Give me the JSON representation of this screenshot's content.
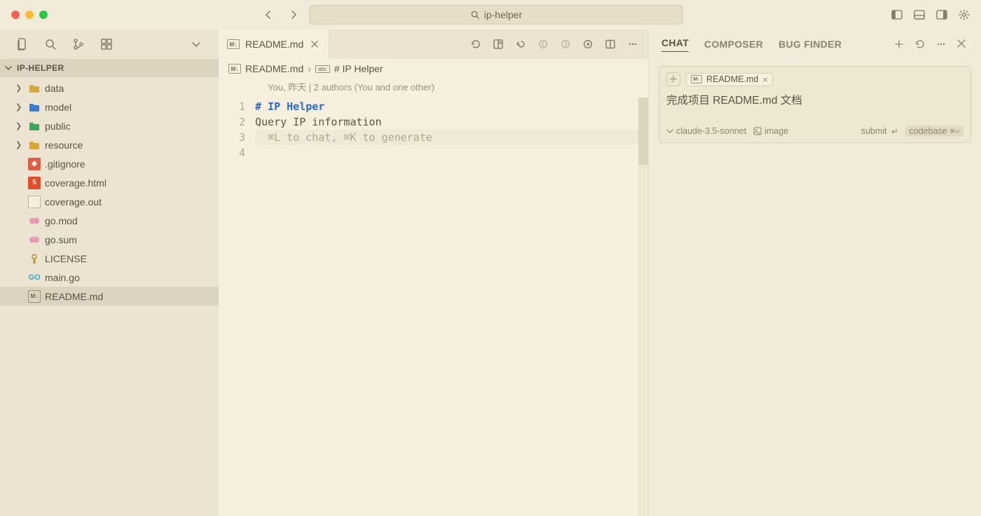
{
  "title": "ip-helper",
  "sidebar": {
    "project_name": "IP-HELPER",
    "items": [
      {
        "name": "data",
        "type": "folder"
      },
      {
        "name": "model",
        "type": "folder",
        "iconTint": "blue"
      },
      {
        "name": "public",
        "type": "folder",
        "iconTint": "green"
      },
      {
        "name": "resource",
        "type": "folder"
      },
      {
        "name": ".gitignore",
        "type": "file",
        "icon": "git"
      },
      {
        "name": "coverage.html",
        "type": "file",
        "icon": "html5"
      },
      {
        "name": "coverage.out",
        "type": "file",
        "icon": "blank"
      },
      {
        "name": "go.mod",
        "type": "file",
        "icon": "gopink"
      },
      {
        "name": "go.sum",
        "type": "file",
        "icon": "gopink"
      },
      {
        "name": "LICENSE",
        "type": "file",
        "icon": "key"
      },
      {
        "name": "main.go",
        "type": "file",
        "icon": "go"
      },
      {
        "name": "README.md",
        "type": "file",
        "icon": "md",
        "selected": true
      }
    ]
  },
  "editor": {
    "tab_label": "README.md",
    "breadcrumb": {
      "file": "README.md",
      "symbol": "# IP Helper"
    },
    "authors_line": "You, 昨天 | 2 authors (You and one other)",
    "lines": {
      "l1": "# IP Helper",
      "l2": "",
      "l3": "Query IP information"
    },
    "hint": "⌘L to chat, ⌘K to generate"
  },
  "right_panel": {
    "tabs": {
      "chat": "CHAT",
      "composer": "COMPOSER",
      "bug": "BUG FINDER"
    },
    "chip_file": "README.md",
    "prompt": "完成项目 README.md 文档",
    "model": "claude-3.5-sonnet",
    "image_label": "image",
    "submit_label": "submit",
    "codebase_label": "codebase",
    "codebase_kbd": "⌘⏎"
  }
}
